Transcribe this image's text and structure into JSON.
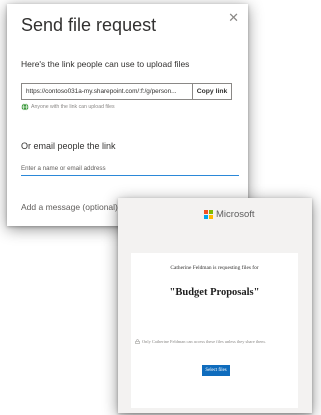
{
  "dialog": {
    "title": "Send file request",
    "close_icon": "close-icon",
    "link_heading": "Here's the link people can use to upload files",
    "link_value": "https://contoso031a-my.sharepoint.com/:f:/g/person...",
    "copy_button": "Copy link",
    "permission_icon": "globe-icon",
    "permission_note": "Anyone with the link can upload files",
    "email_heading": "Or email people the link",
    "email_placeholder": "Enter a name or email address",
    "message_placeholder": "Add a message (optional)"
  },
  "email_card": {
    "brand_name": "Microsoft",
    "brand_colors": [
      "#f25022",
      "#7fba00",
      "#00a4ef",
      "#ffb900"
    ],
    "requester_line": "Catherine Feldman is requesting files for",
    "folder_title": "\"Budget Proposals\"",
    "privacy_icon": "lock-icon",
    "privacy_note": "Only Catherine Feldman can access these files unless they share them.",
    "select_button": "Select files",
    "button_color": "#0f6cbd"
  }
}
